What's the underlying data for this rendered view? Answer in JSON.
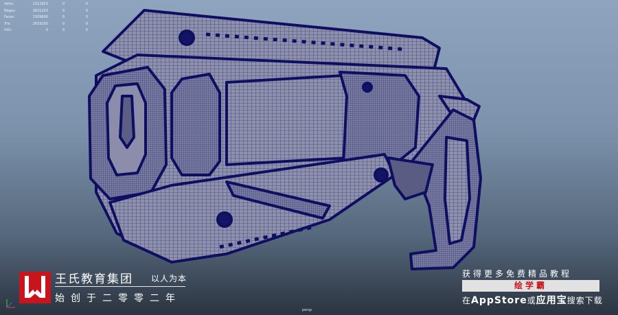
{
  "stats": {
    "rows": [
      {
        "label": "Verts:",
        "values": [
          "1311653",
          "0",
          "0"
        ]
      },
      {
        "label": "Edges:",
        "values": [
          "2621223",
          "0",
          "0"
        ]
      },
      {
        "label": "Faces:",
        "values": [
          "1309600",
          "0",
          "0"
        ]
      },
      {
        "label": "Tris:",
        "values": [
          "2619200",
          "0",
          "0"
        ]
      },
      {
        "label": "UVs:",
        "values": [
          "0",
          "0",
          "0"
        ]
      }
    ]
  },
  "viewport": {
    "camera_label": "persp",
    "background_top": "#8ea4bf",
    "background_bottom": "#2b3440",
    "wireframe_color": "#14146e",
    "model_surface_color": "#8c8ea8"
  },
  "brand": {
    "name": "王氏教育集团",
    "slogan": "以人为本",
    "year": "始创于二零零二年",
    "logo_color": "#c8141c"
  },
  "promo": {
    "top": "获得更多免费精品教程",
    "app_name": "绘学霸",
    "bottom_prefix": "在",
    "store1": "AppStore",
    "bottom_mid": "或",
    "store2": "应用宝",
    "bottom_suffix": "搜索下载"
  }
}
